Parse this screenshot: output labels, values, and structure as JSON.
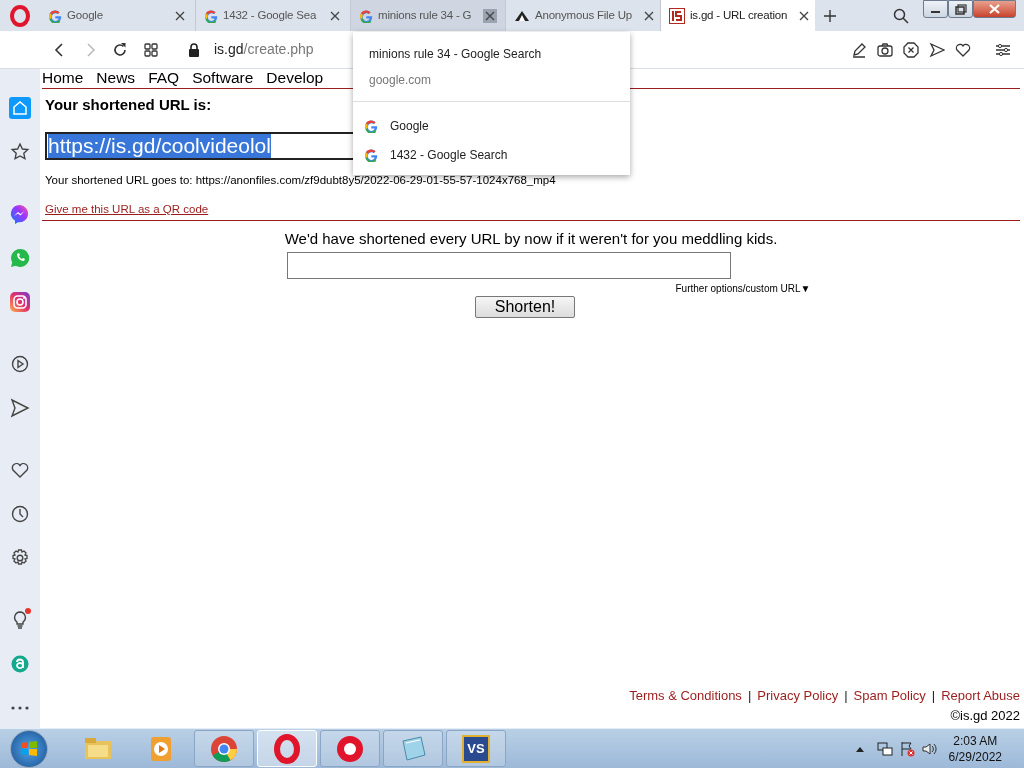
{
  "tabs": [
    {
      "title": "Google",
      "kind": "g",
      "selected": false
    },
    {
      "title": "1432 - Google Sea",
      "kind": "g",
      "selected": false
    },
    {
      "title": "minions rule 34 - G",
      "kind": "g",
      "selected": false,
      "hovered": true
    },
    {
      "title": "Anonymous File Up",
      "kind": "tent",
      "selected": false
    },
    {
      "title": "is.gd - URL creation",
      "kind": "isgd",
      "selected": true
    }
  ],
  "address_bar": {
    "host": "is.gd",
    "path": "/create.php",
    "back_disabled": false,
    "forward_disabled": true
  },
  "tab_preview": {
    "title": "minions rule 34 - Google Search",
    "domain": "google.com",
    "items": [
      "Google",
      "1432 - Google Search"
    ]
  },
  "sidebar": {
    "items": [
      {
        "kind": "home",
        "selected": true
      },
      {
        "kind": "star",
        "selected": false
      },
      {
        "kind": "divider"
      },
      {
        "kind": "messenger",
        "selected": false
      },
      {
        "kind": "whatsapp",
        "selected": false
      },
      {
        "kind": "instagram",
        "selected": false
      },
      {
        "kind": "divider"
      },
      {
        "kind": "player",
        "selected": false
      },
      {
        "kind": "send",
        "selected": false
      },
      {
        "kind": "divider"
      },
      {
        "kind": "heart",
        "selected": false
      },
      {
        "kind": "clock",
        "selected": false
      },
      {
        "kind": "gear",
        "selected": false
      },
      {
        "kind": "divider"
      },
      {
        "kind": "bulb",
        "selected": false,
        "notification": true
      },
      {
        "kind": "aria",
        "selected": false
      },
      {
        "kind": "more",
        "selected": false
      }
    ]
  },
  "page": {
    "nav": [
      "Home",
      "News",
      "FAQ",
      "Software",
      "Develop"
    ],
    "heading": "Your shortened URL is:",
    "short_url": "https://is.gd/coolvideolol",
    "goes_to": "Your shortened URL goes to: https://anonfiles.com/zf9dubt8y5/2022-06-29-01-55-57-1024x768_mp4",
    "qr_link": "Give me this URL as a QR code",
    "tagline": "We'd have shortened every URL by now if it weren't for you meddling kids.",
    "options_link": "Further options/custom URL▼",
    "button": "Shorten!",
    "footer_links": [
      "Terms & Conditions",
      "Privacy Policy",
      "Spam Policy",
      "Report Abuse"
    ],
    "footer_separator": "|",
    "copyright": "©is.gd 2022"
  },
  "taskbar": {
    "apps": [
      {
        "kind": "explorer",
        "running": false
      },
      {
        "kind": "media",
        "running": false
      },
      {
        "kind": "chrome",
        "running": true
      },
      {
        "kind": "opera",
        "running": true,
        "active": true
      },
      {
        "kind": "record",
        "running": true
      },
      {
        "kind": "notepad",
        "running": true
      },
      {
        "kind": "vs",
        "running": true,
        "label": "VS"
      }
    ],
    "time": "2:03 AM",
    "date": "6/29/2022"
  }
}
